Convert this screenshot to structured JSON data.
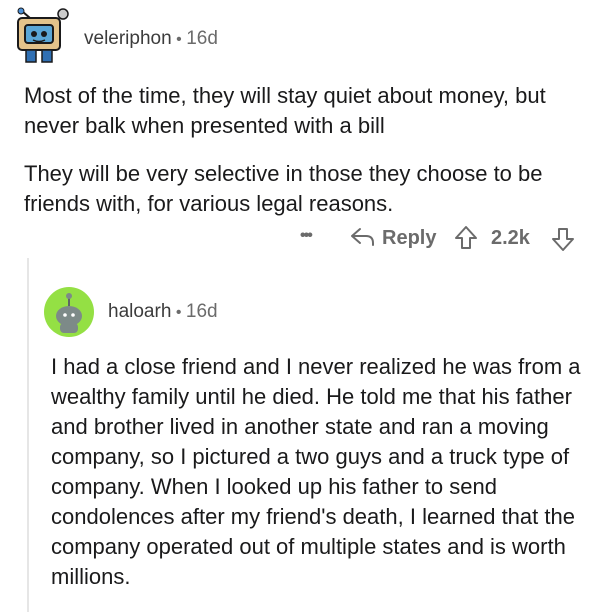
{
  "comment": {
    "username": "veleriphon",
    "separator": "•",
    "age": "16d",
    "paragraphs": [
      "Most of the time, they will stay quiet about money, but never balk when presented with a bill",
      "They will be very selective in those they choose to be friends with, for various legal reasons."
    ],
    "actions": {
      "more": "•••",
      "reply": "Reply",
      "score": "2.2k"
    }
  },
  "reply": {
    "username": "haloarh",
    "separator": "•",
    "age": "16d",
    "text": "I had a close friend and I never realized he was from a wealthy family until he died. He told me that his father and brother lived in another state and ran a moving company, so I pictured a two guys and a truck type of company. When I looked up his father to send condolences after my friend's death, I learned that the company operated out of multiple states and is worth millions."
  }
}
